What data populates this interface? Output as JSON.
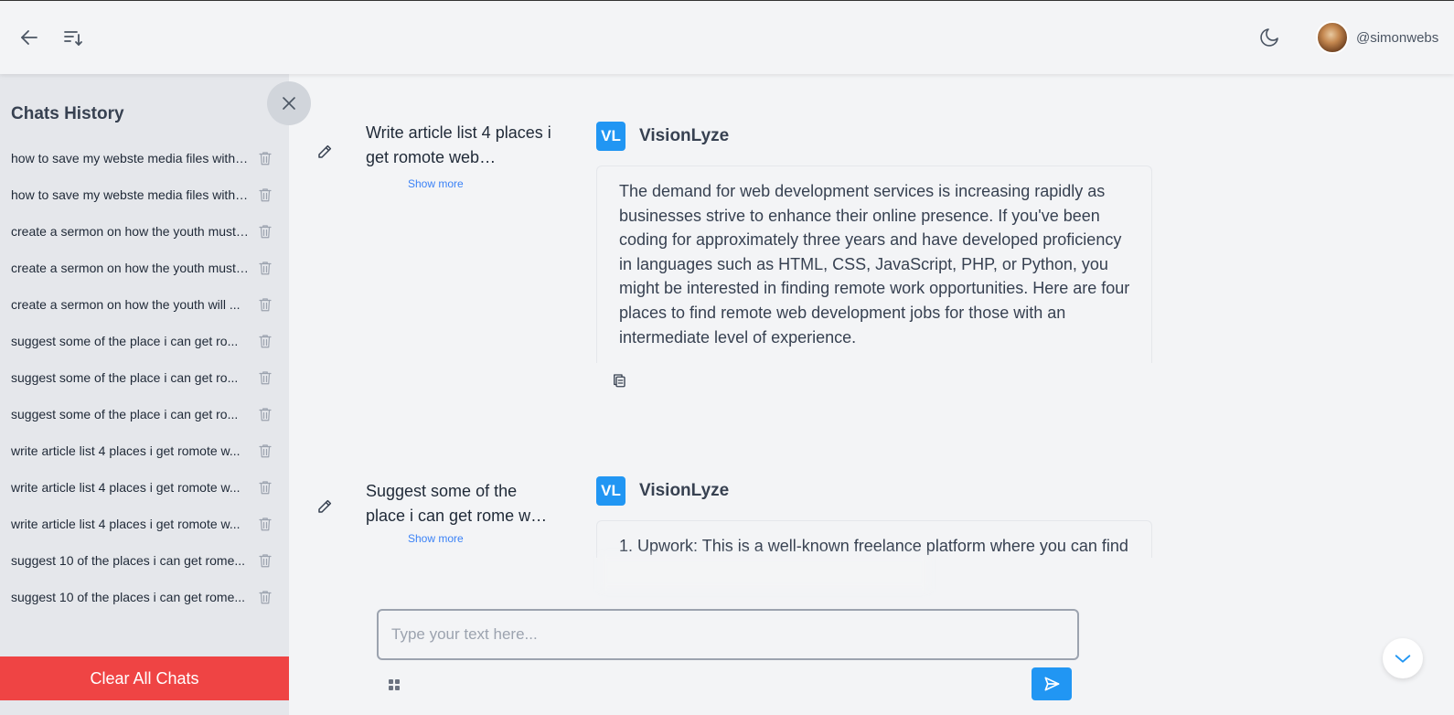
{
  "header": {
    "username": "@simonwebs"
  },
  "sidebar": {
    "title": "Chats History",
    "clear_label": "Clear All Chats",
    "items": [
      {
        "label": "how to save my webste media files with ..."
      },
      {
        "label": "how to save my webste media files with ..."
      },
      {
        "label": "create a sermon on how the youth must ..."
      },
      {
        "label": "create a sermon on how the youth must ..."
      },
      {
        "label": "create a sermon on how the youth will ..."
      },
      {
        "label": "suggest some of the place i can get ro..."
      },
      {
        "label": "suggest some of the place i can get ro..."
      },
      {
        "label": "suggest some of the place i can get ro..."
      },
      {
        "label": "write article list 4 places i get romote w..."
      },
      {
        "label": "write article list 4 places i get romote w..."
      },
      {
        "label": "write article list 4 places i get romote w..."
      },
      {
        "label": "suggest 10 of the places i can get rome..."
      },
      {
        "label": "suggest 10 of the places i can get rome..."
      }
    ]
  },
  "messages": [
    {
      "prompt": "Write article list 4 places i get romote web…",
      "show_more": "Show more",
      "bot_badge": "VL",
      "bot_name": "VisionLyze",
      "answer": "The demand for web development services is increasing rapidly as businesses strive to enhance their online presence. If you've been coding for approximately three years and have developed proficiency in languages such as HTML, CSS, JavaScript, PHP, or Python, you might be interested in finding remote work opportunities. Here are four places to find remote web development jobs for those with an intermediate level of experience."
    },
    {
      "prompt": "Suggest some of the place i can get rome w…",
      "show_more": "Show more",
      "bot_badge": "VL",
      "bot_name": "VisionLyze",
      "answer": "1. Upwork: This is a well-known freelance platform where you can find"
    }
  ],
  "composer": {
    "placeholder": "Type your text here..."
  },
  "colors": {
    "accent": "#2196f3",
    "danger": "#ef4444",
    "link": "#3b82f6"
  },
  "icons": [
    "back-arrow-icon",
    "sort-list-icon",
    "moon-icon",
    "close-icon",
    "trash-icon",
    "pencil-icon",
    "copy-icon",
    "grid-icon",
    "send-icon",
    "chevron-down-icon"
  ]
}
